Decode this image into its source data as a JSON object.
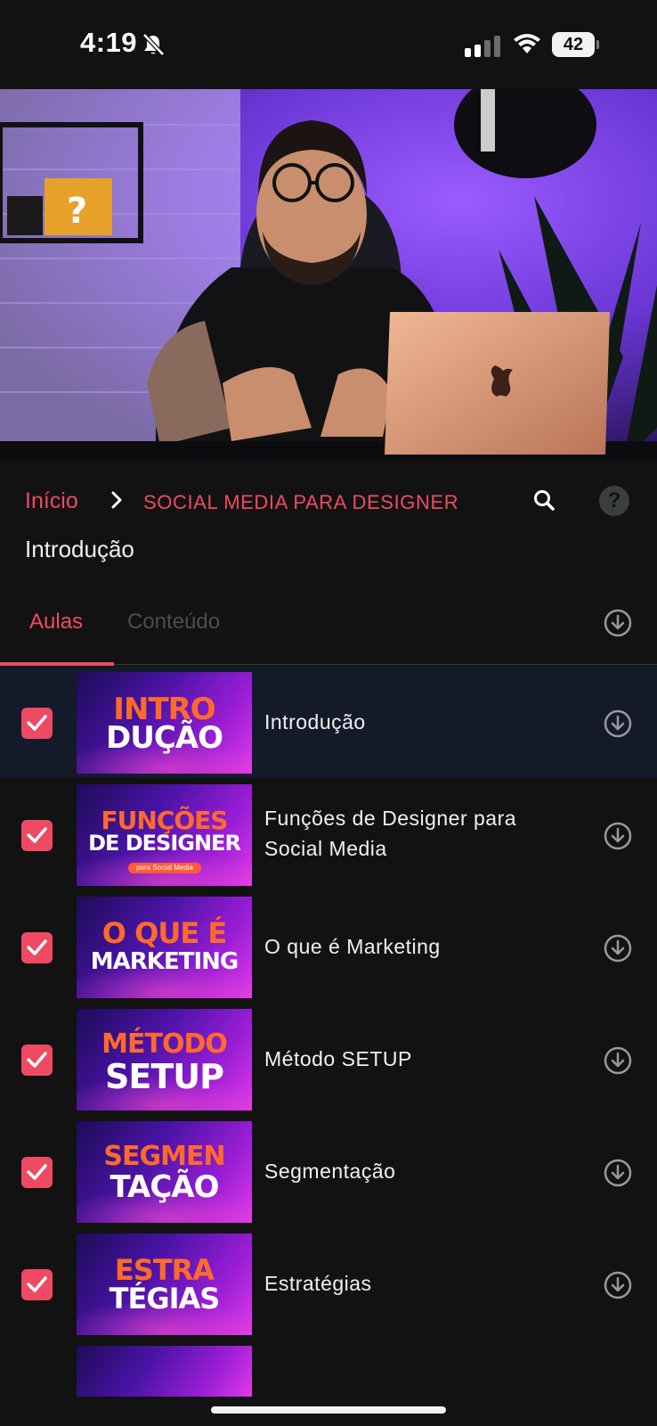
{
  "status_bar": {
    "time": "4:19",
    "battery": "42",
    "icons": [
      "bell-slash-icon",
      "cellular-signal-icon",
      "wifi-icon",
      "battery-icon"
    ]
  },
  "video": {
    "description_icon": "video-player",
    "colors": {
      "backdrop": "#6a35d0"
    }
  },
  "breadcrumb": {
    "home": "Início",
    "course": "SOCIAL MEDIA PARA DESIGNER"
  },
  "lesson_title": "Introdução",
  "tabs": {
    "lessons": "Aulas",
    "content": "Conteúdo"
  },
  "lessons": [
    {
      "title": "Introdução",
      "thumb_line1": "INTRO",
      "thumb_line2": "DUÇÃO",
      "completed": true,
      "active": true
    },
    {
      "title": "Funções de Designer para Social Media",
      "title_line1": "Funções de Designer para",
      "title_line2": "Social Media",
      "thumb_line1": "FUNÇÕES",
      "thumb_line2": "DE DESIGNER",
      "thumb_line3": "para Social Media",
      "completed": true,
      "active": false
    },
    {
      "title": "O que é Marketing",
      "thumb_line1": "O QUE É",
      "thumb_line2": "MARKETING",
      "completed": true,
      "active": false
    },
    {
      "title": "Método SETUP",
      "thumb_line1": "MÉTODO",
      "thumb_line2": "SETUP",
      "completed": true,
      "active": false
    },
    {
      "title": "Segmentação",
      "thumb_line1": "SEGMEN",
      "thumb_line2": "TAÇÃO",
      "completed": true,
      "active": false
    },
    {
      "title": "Estratégias",
      "thumb_line1": "ESTRA",
      "thumb_line2": "TÉGIAS",
      "completed": true,
      "active": false
    }
  ],
  "colors": {
    "accent": "#ef4a63",
    "background": "#121212",
    "active_row": "#141a2a",
    "inactive_tab": "#4d4d4d"
  }
}
